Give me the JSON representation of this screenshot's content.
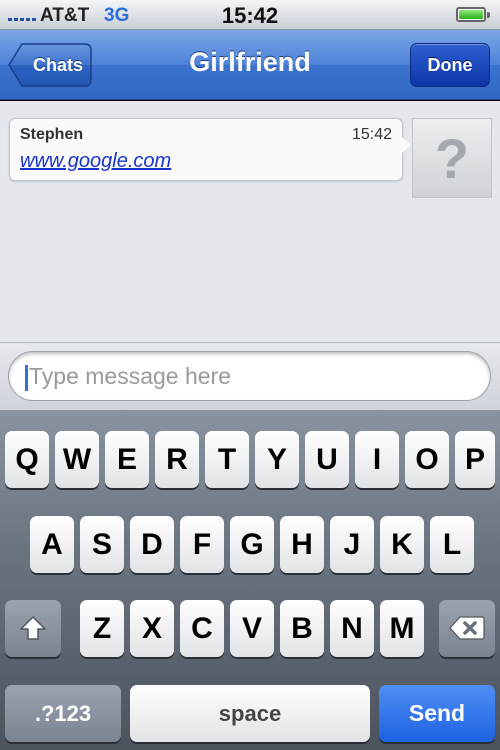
{
  "status_bar": {
    "carrier": "AT&T",
    "network": "3G",
    "time": "15:42",
    "battery_level": 1.0
  },
  "nav": {
    "back_label": "Chats",
    "title": "Girlfriend",
    "done_label": "Done"
  },
  "message": {
    "sender": "Stephen",
    "time": "15:42",
    "text": "www.google.com",
    "avatar_icon": "question-mark-icon"
  },
  "input": {
    "placeholder": "Type message here",
    "value": ""
  },
  "keyboard": {
    "row1": [
      "Q",
      "W",
      "E",
      "R",
      "T",
      "Y",
      "U",
      "I",
      "O",
      "P"
    ],
    "row2": [
      "A",
      "S",
      "D",
      "F",
      "G",
      "H",
      "J",
      "K",
      "L"
    ],
    "row3": [
      "Z",
      "X",
      "C",
      "V",
      "B",
      "N",
      "M"
    ],
    "shift_icon": "shift-arrow-icon",
    "delete_icon": "backspace-icon",
    "mode_label": ".?123",
    "space_label": "space",
    "send_label": "Send"
  },
  "colors": {
    "nav_blue": "#3d74cf",
    "send_blue": "#1e62e0",
    "link_blue": "#1a35c9"
  }
}
